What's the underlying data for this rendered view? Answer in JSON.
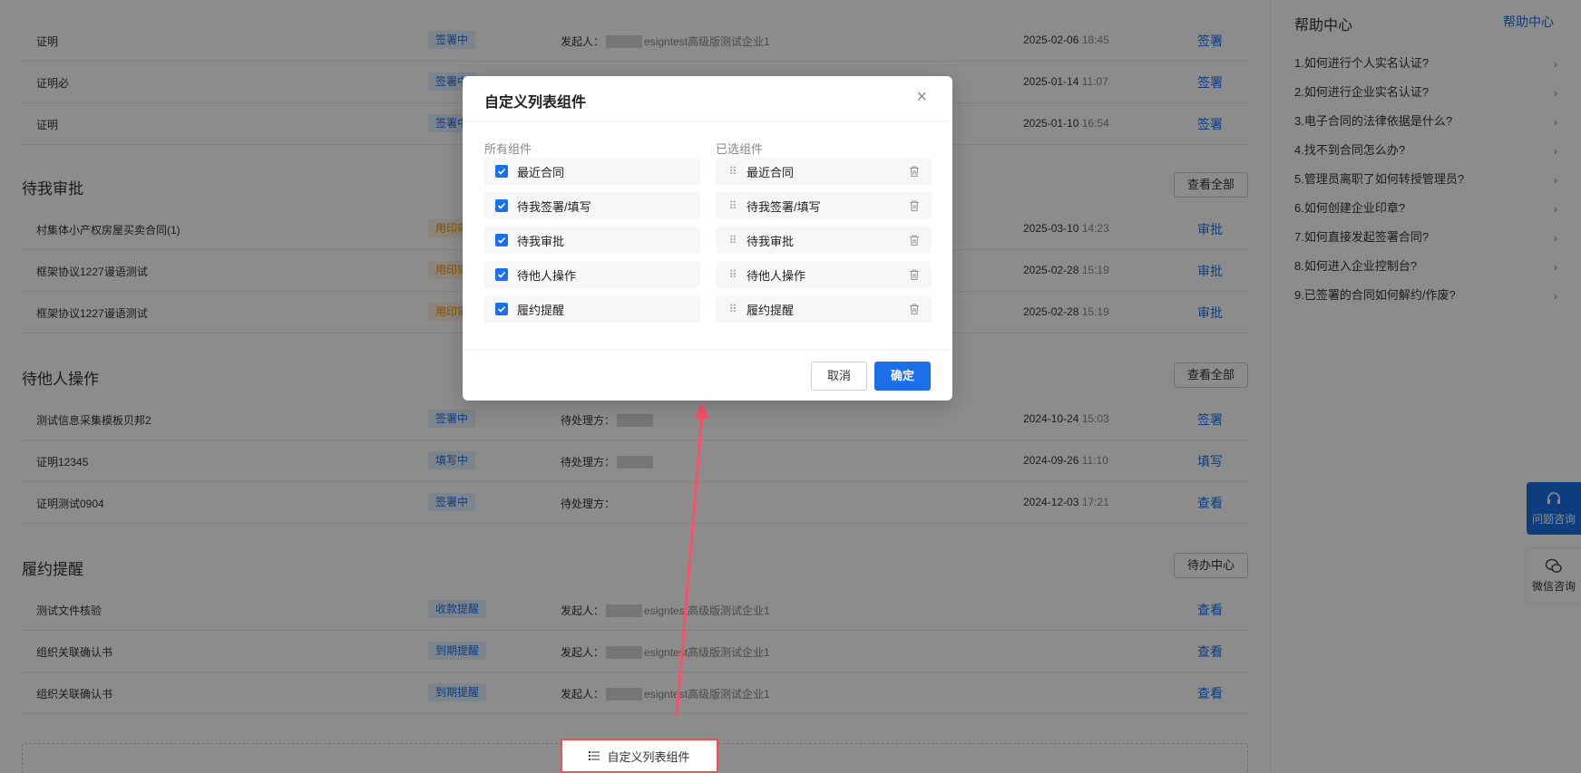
{
  "sections": {
    "signing_rows": [
      {
        "name": "证明",
        "badge": "签署中",
        "party_label": "发起人：",
        "org": "esigntest高级版测试企业1",
        "date": "2025-02-06",
        "time": "18:45",
        "action": "签署"
      },
      {
        "name": "证明必",
        "badge": "签署中",
        "party_label": "",
        "org": "",
        "date": "2025-01-14",
        "time": "11:07",
        "action": "签署"
      },
      {
        "name": "证明",
        "badge": "签署中",
        "party_label": "",
        "org": "",
        "date": "2025-01-10",
        "time": "16:54",
        "action": "签署"
      }
    ],
    "approval": {
      "title": "待我审批",
      "view_all": "查看全部",
      "rows": [
        {
          "name": "村集体小产权房屋买卖合同(1)",
          "badge": "用印审",
          "date": "2025-03-10",
          "time": "14:23",
          "action": "审批"
        },
        {
          "name": "框架协议1227谩语测试",
          "badge": "用印审",
          "date": "2025-02-28",
          "time": "15:19",
          "action": "审批"
        },
        {
          "name": "框架协议1227谩语测试",
          "badge": "用印审",
          "date": "2025-02-28",
          "time": "15:19",
          "action": "审批"
        }
      ]
    },
    "others": {
      "title": "待他人操作",
      "view_all": "查看全部",
      "rows": [
        {
          "name": "测试信息采集模板贝邦2",
          "badge": "签署中",
          "party_label": "待处理方：",
          "date": "2024-10-24",
          "time": "15:03",
          "action": "签署"
        },
        {
          "name": "证明12345",
          "badge": "填写中",
          "party_label": "待处理方：",
          "date": "2024-09-26",
          "time": "11:10",
          "action": "填写"
        },
        {
          "name": "证明测试0904",
          "badge": "签署中",
          "party_label": "待处理方：",
          "date": "2024-12-03",
          "time": "17:21",
          "action": "查看"
        }
      ]
    },
    "reminder": {
      "title": "履约提醒",
      "view_all": "待办中心",
      "rows": [
        {
          "name": "测试文件核验",
          "badge": "收款提醒",
          "party_label": "发起人：",
          "org": "esigntest高级版测试企业1",
          "action": "查看"
        },
        {
          "name": "组织关联确认书",
          "badge": "到期提醒",
          "party_label": "发起人：",
          "org": "esigntest高级版测试企业1",
          "action": "查看"
        },
        {
          "name": "组织关联确认书",
          "badge": "到期提醒",
          "party_label": "发起人：",
          "org": "esigntest高级版测试企业1",
          "action": "查看"
        }
      ]
    },
    "customize_label": "自定义列表组件"
  },
  "help": {
    "title": "帮助中心",
    "link": "帮助中心",
    "items": [
      "1.如何进行个人实名认证?",
      "2.如何进行企业实名认证?",
      "3.电子合同的法律依据是什么?",
      "4.找不到合同怎么办?",
      "5.管理员离职了如何转授管理员?",
      "6.如何创建企业印章?",
      "7.如何直接发起签署合同?",
      "8.如何进入企业控制台?",
      "9.已签署的合同如何解约/作废?"
    ]
  },
  "float": {
    "consult": "问题咨询",
    "wechat": "微信咨询"
  },
  "modal": {
    "title": "自定义列表组件",
    "all_title": "所有组件",
    "selected_title": "已选组件",
    "all_items": [
      "最近合同",
      "待我签署/填写",
      "待我审批",
      "待他人操作",
      "履约提醒"
    ],
    "selected_items": [
      "最近合同",
      "待我签署/填写",
      "待我审批",
      "待他人操作",
      "履约提醒"
    ],
    "cancel": "取消",
    "ok": "确定"
  },
  "colors": {
    "accent": "#1b6fe8",
    "highlight": "#ff4d4f",
    "overlay": "rgba(0,0,0,0.45)"
  }
}
